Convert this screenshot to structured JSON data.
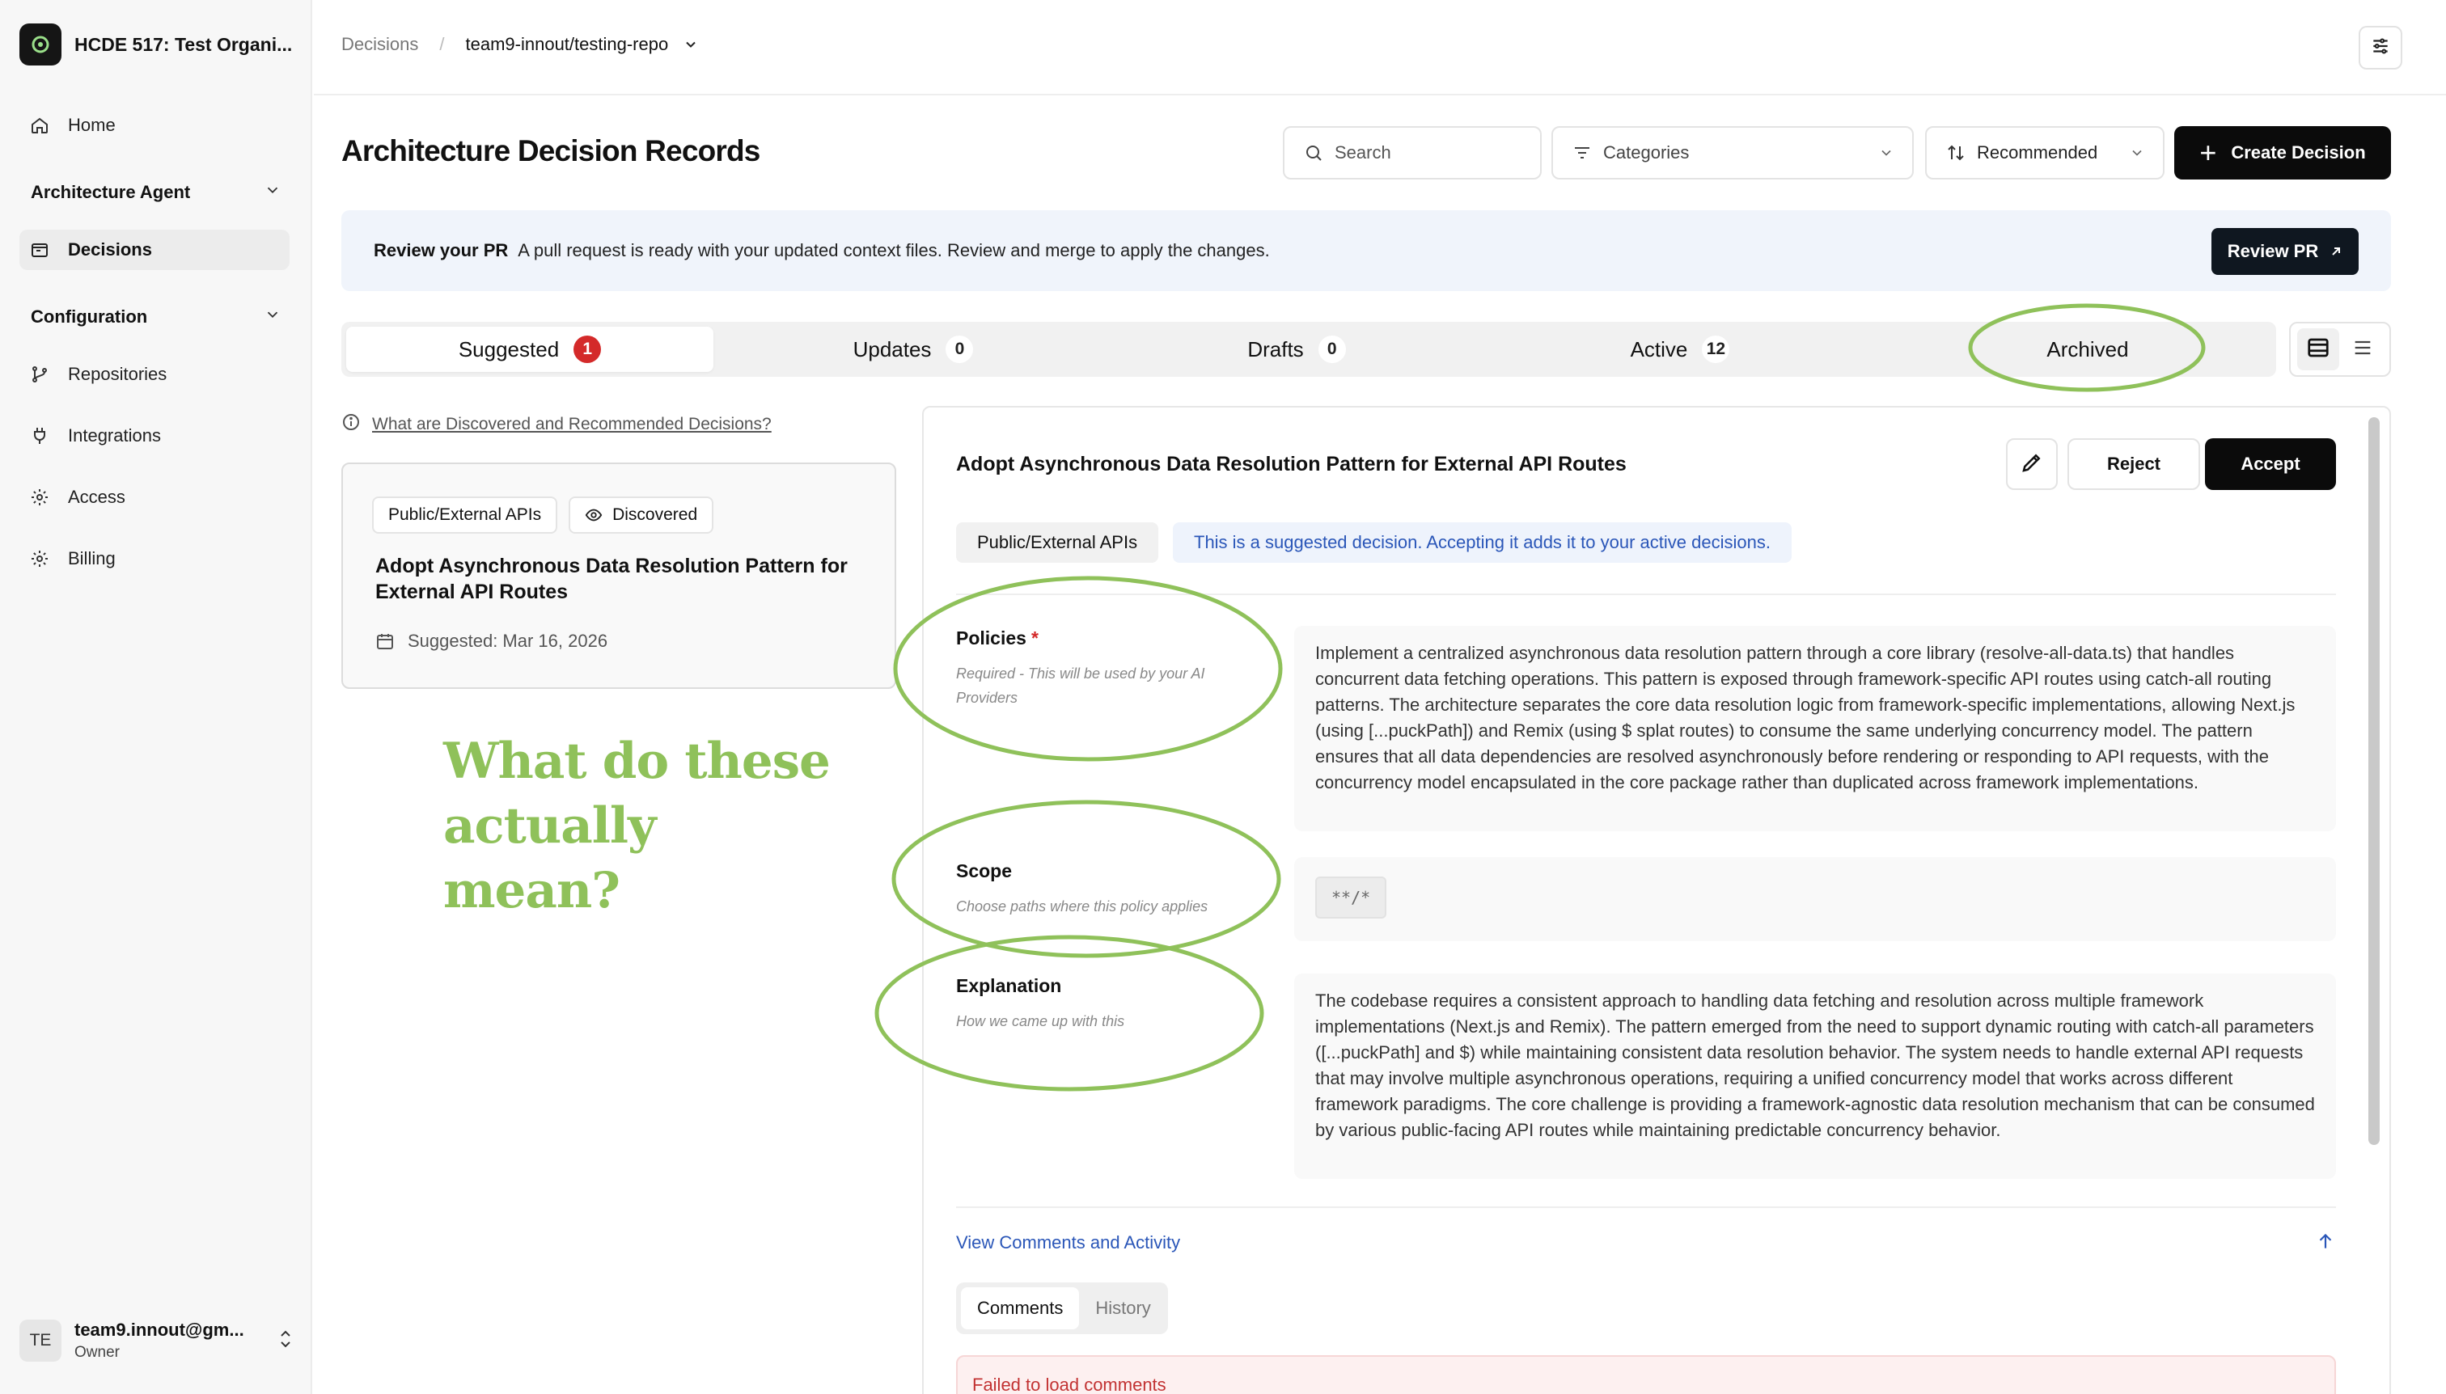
{
  "sidebar": {
    "org_name": "HCDE 517: Test Organi...",
    "items": {
      "home": "Home",
      "architecture_agent": "Architecture Agent",
      "decisions": "Decisions",
      "configuration": "Configuration",
      "repositories": "Repositories",
      "integrations": "Integrations",
      "access": "Access",
      "billing": "Billing"
    },
    "user": {
      "initials": "TE",
      "email": "team9.innout@gm...",
      "role": "Owner"
    }
  },
  "topbar": {
    "breadcrumb_root": "Decisions",
    "breadcrumb_sep": "/",
    "repo": "team9-innout/testing-repo"
  },
  "header": {
    "title": "Architecture Decision Records",
    "search_placeholder": "Search",
    "categories": "Categories",
    "sort": "Recommended",
    "create": "Create Decision"
  },
  "banner": {
    "title": "Review your PR",
    "message": "A pull request is ready with your updated context files. Review and merge to apply the changes.",
    "button": "Review PR"
  },
  "tabs": [
    {
      "label": "Suggested",
      "count": "1"
    },
    {
      "label": "Updates",
      "count": "0"
    },
    {
      "label": "Drafts",
      "count": "0"
    },
    {
      "label": "Active",
      "count": "12"
    },
    {
      "label": "Archived"
    }
  ],
  "list": {
    "help_link": "What are Discovered and Recommended Decisions?",
    "card": {
      "category": "Public/External APIs",
      "status": "Discovered",
      "title": "Adopt Asynchronous Data Resolution Pattern for External API Routes",
      "date": "Suggested: Mar 16, 2026"
    }
  },
  "annotation": {
    "note_line1": "What do these actually",
    "note_line2": "mean?",
    "color": "#8fc15a"
  },
  "detail": {
    "title": "Adopt Asynchronous Data Resolution Pattern for External API Routes",
    "reject": "Reject",
    "accept": "Accept",
    "category": "Public/External APIs",
    "info": "This is a suggested decision. Accepting it adds it to your active decisions.",
    "policies": {
      "label": "Policies",
      "required_mark": "*",
      "hint": "Required - This will be used by your AI Providers",
      "text": "Implement a centralized asynchronous data resolution pattern through a core library (resolve-all-data.ts) that handles concurrent data fetching operations. This pattern is exposed through framework-specific API routes using catch-all routing patterns. The architecture separates the core data resolution logic from framework-specific implementations, allowing Next.js (using [...puckPath]) and Remix (using $ splat routes) to consume the same underlying concurrency model. The pattern ensures that all data dependencies are resolved asynchronously before rendering or responding to API requests, with the concurrency model encapsulated in the core package rather than duplicated across framework implementations."
    },
    "scope": {
      "label": "Scope",
      "hint": "Choose paths where this policy applies",
      "value": "**/*"
    },
    "explanation": {
      "label": "Explanation",
      "hint": "How we came up with this",
      "text": "The codebase requires a consistent approach to handling data fetching and resolution across multiple framework implementations (Next.js and Remix). The pattern emerged from the need to support dynamic routing with catch-all parameters ([...puckPath] and $) while maintaining consistent data resolution behavior. The system needs to handle external API requests that may involve multiple asynchronous operations, requiring a unified concurrency model that works across different framework paradigms. The core challenge is providing a framework-agnostic data resolution mechanism that can be consumed by various public-facing API routes while maintaining predictable concurrency behavior."
    },
    "comments_link": "View Comments and Activity",
    "comment_tabs": [
      "Comments",
      "History"
    ],
    "error": "Failed to load comments"
  }
}
